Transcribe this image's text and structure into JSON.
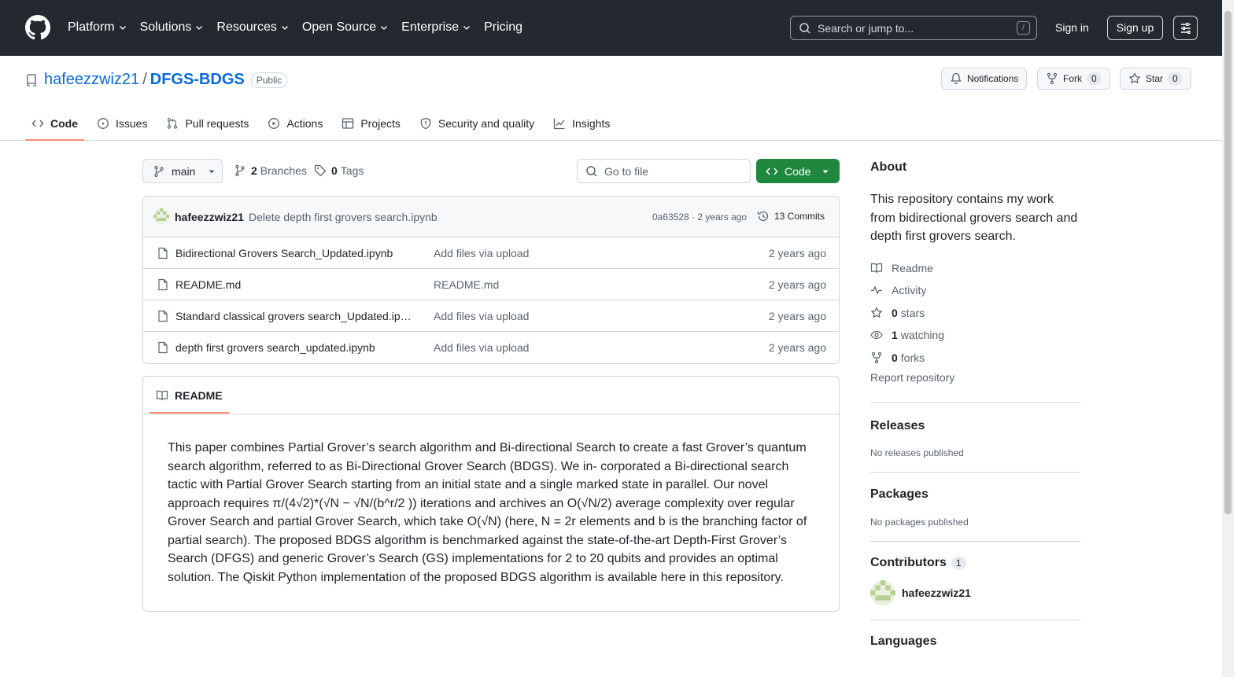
{
  "header": {
    "nav": [
      "Platform",
      "Solutions",
      "Resources",
      "Open Source",
      "Enterprise",
      "Pricing"
    ],
    "nav_has_dropdown": [
      true,
      true,
      true,
      true,
      true,
      false
    ],
    "search_placeholder": "Search or jump to...",
    "search_shortcut": "/",
    "sign_in": "Sign in",
    "sign_up": "Sign up"
  },
  "repo": {
    "owner": "hafeezzwiz21",
    "separator": "/",
    "name": "DFGS-BDGS",
    "visibility": "Public",
    "notifications_label": "Notifications",
    "fork_label": "Fork",
    "fork_count": "0",
    "star_label": "Star",
    "star_count": "0"
  },
  "tabs": [
    {
      "label": "Code",
      "icon": "code-icon",
      "active": true
    },
    {
      "label": "Issues",
      "icon": "issue-icon"
    },
    {
      "label": "Pull requests",
      "icon": "pull-request-icon"
    },
    {
      "label": "Actions",
      "icon": "play-icon"
    },
    {
      "label": "Projects",
      "icon": "table-icon"
    },
    {
      "label": "Security and quality",
      "icon": "shield-icon"
    },
    {
      "label": "Insights",
      "icon": "graph-icon"
    }
  ],
  "toolbar": {
    "branch": "main",
    "branches_count": "2",
    "branches_label": "Branches",
    "tags_count": "0",
    "tags_label": "Tags",
    "goto_placeholder": "Go to file",
    "code_button": "Code"
  },
  "commit": {
    "author": "hafeezzwiz21",
    "message": "Delete depth first grovers search.ipynb",
    "sha_time": "0a63528 · 2 years ago",
    "commits": "13 Commits"
  },
  "files": [
    {
      "name": "Bidirectional Grovers Search_Updated.ipynb",
      "message": "Add files via upload",
      "age": "2 years ago"
    },
    {
      "name": "README.md",
      "message": "README.md",
      "age": "2 years ago"
    },
    {
      "name": "Standard classical grovers search_Updated.ipynb",
      "message": "Add files via upload",
      "age": "2 years ago"
    },
    {
      "name": "depth first grovers search_updated.ipynb",
      "message": "Add files via upload",
      "age": "2 years ago"
    }
  ],
  "readme": {
    "tab_label": "README",
    "body": "This paper combines Partial Grover’s search algorithm and Bi-directional Search to create a fast Grover’s quantum search algorithm, referred to as Bi-Directional Grover Search (BDGS). We in- corporated a Bi-directional search tactic with Partial Grover Search starting from an initial state and a single marked state in parallel. Our novel approach requires π/(4√2)*(√N − √N/(b^r/2 )) iterations and archives an O(√N/2) average complexity over regular Grover Search and partial Grover Search, which take O(√N) (here, N = 2r elements and b is the branching factor of partial search). The proposed BDGS algorithm is benchmarked against the state-of-the-art Depth-First Grover’s Search (DFGS) and generic Grover’s Search (GS) implementations for 2 to 20 qubits and provides an optimal solution. The Qiskit Python implementation of the proposed BDGS algorithm is available here in this repository."
  },
  "sidebar": {
    "about_title": "About",
    "about_desc": "This repository contains my work from bidirectional grovers search and depth first grovers search.",
    "readme": "Readme",
    "activity": "Activity",
    "stars_count": "0",
    "stars_label": "stars",
    "watching_count": "1",
    "watching_label": "watching",
    "forks_count": "0",
    "forks_label": "forks",
    "report": "Report repository",
    "releases_title": "Releases",
    "releases_note": "No releases published",
    "packages_title": "Packages",
    "packages_note": "No packages published",
    "contributors_title": "Contributors",
    "contributors_count": "1",
    "contributor_name": "hafeezzwiz21",
    "languages_title": "Languages"
  },
  "colors": {
    "header_bg": "#24292f",
    "link": "#0969da",
    "code_button": "#1f883d",
    "active_tab_underline": "#fd8c73"
  }
}
